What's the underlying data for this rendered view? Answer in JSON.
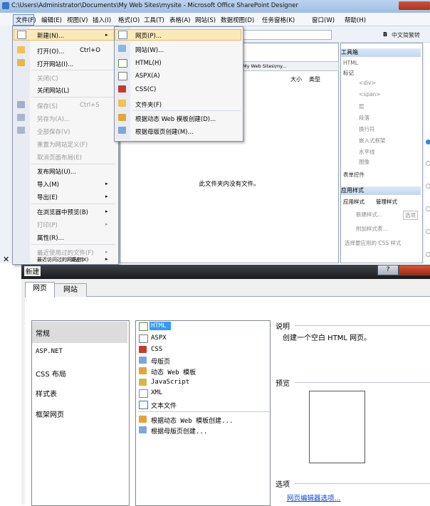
{
  "colors": {
    "accent": "#3399ff",
    "menu_highlight": "#fce9b9",
    "link": "#0645d6",
    "title_dark": "#181a1d"
  },
  "top": {
    "window_title": "C:\\Users\\Administrator\\Documents\\My Web Sites\\mysite - Microsoft Office SharePoint Designer",
    "menubar": [
      "文件(F)",
      "编辑(E)",
      "视图(V)",
      "插入(I)",
      "格式(O)",
      "工具(T)",
      "表格(A)",
      "网站(S)",
      "数据视图(D)",
      "任务窗格(K)",
      "窗口(W)",
      "帮助(H)"
    ],
    "toolbar_font": "中文简繁转",
    "toolbar_misc": "B",
    "file_menu": [
      {
        "label": "新建(N)...",
        "shortcut": "",
        "arrow": "▸",
        "disabled": false,
        "icon": "new-icon"
      },
      {
        "label": "打开(O)...",
        "shortcut": "Ctrl+O",
        "arrow": "",
        "disabled": false,
        "icon": "open-folder-icon"
      },
      {
        "label": "打开网站(I)...",
        "shortcut": "",
        "arrow": "",
        "disabled": false,
        "icon": "open-site-icon"
      },
      {
        "label": "关闭(C)",
        "shortcut": "",
        "arrow": "",
        "disabled": true,
        "icon": ""
      },
      {
        "label": "关闭网站(L)",
        "shortcut": "",
        "arrow": "",
        "disabled": false,
        "icon": ""
      },
      {
        "label": "保存(S)",
        "shortcut": "Ctrl+S",
        "arrow": "",
        "disabled": true,
        "icon": "save-icon"
      },
      {
        "label": "另存为(A)...",
        "shortcut": "",
        "arrow": "",
        "disabled": true,
        "icon": "save-as-icon"
      },
      {
        "label": "全部保存(V)",
        "shortcut": "",
        "arrow": "",
        "disabled": true,
        "icon": "save-all-icon"
      },
      {
        "label": "重置为网站定义(F)",
        "shortcut": "",
        "arrow": "",
        "disabled": true,
        "icon": ""
      },
      {
        "label": "取消页面布局(E)",
        "shortcut": "",
        "arrow": "",
        "disabled": true,
        "icon": ""
      },
      {
        "label": "发布网站(U)...",
        "shortcut": "",
        "arrow": "",
        "disabled": false,
        "icon": ""
      },
      {
        "label": "导入(M)",
        "shortcut": "",
        "arrow": "▸",
        "disabled": false,
        "icon": ""
      },
      {
        "label": "导出(E)",
        "shortcut": "",
        "arrow": "▸",
        "disabled": false,
        "icon": ""
      },
      {
        "label": "在浏览器中预览(B)",
        "shortcut": "",
        "arrow": "▸",
        "disabled": false,
        "icon": ""
      },
      {
        "label": "打印(P)",
        "shortcut": "",
        "arrow": "▸",
        "disabled": true,
        "icon": ""
      },
      {
        "label": "属性(R)...",
        "shortcut": "",
        "arrow": "",
        "disabled": false,
        "icon": ""
      },
      {
        "label": "最近使用过的文件(F)",
        "shortcut": "",
        "arrow": "▸",
        "disabled": true,
        "icon": ""
      },
      {
        "label": "最近访问过的网站(T)",
        "shortcut": "",
        "arrow": "▸",
        "disabled": false,
        "icon": ""
      },
      {
        "label": "退出(X)",
        "shortcut": "",
        "arrow": "",
        "disabled": false,
        "icon": "exit-icon"
      }
    ],
    "new_submenu": [
      "网页(P)...",
      "网站(W)...",
      "HTML(H)",
      "ASPX(A)",
      "CSS(C)",
      "文件夹(F)",
      "根据动态 Web 模板创建(D)...",
      "根据母版页创建(M)..."
    ],
    "path": "My Web Sites\\my...",
    "col_size": "大小",
    "col_type": "类型",
    "empty_msg": "此文件夹内没有文件。",
    "toolbox": {
      "title": "工具箱",
      "section_html": "HTML",
      "tags_header": "标记",
      "items": [
        "<div>",
        "<span>",
        "层",
        "段落",
        "换行符",
        "嵌入式框架",
        "水平线",
        "图像"
      ],
      "form_controls": "表单控件",
      "apply_styles_title": "应用样式",
      "tab_apply": "应用样式",
      "tab_manage": "管理样式",
      "new_style": "新建样式...",
      "options": "选项",
      "attach_style": "附加样式表...",
      "select_css": "选择要应用的 CSS 样式"
    }
  },
  "dialog": {
    "title": "新建",
    "help": "?",
    "tabs": [
      "网页",
      "网站"
    ],
    "categories": [
      "常规",
      "ASP.NET",
      "CSS 布局",
      "样式表",
      "框架网页"
    ],
    "types": [
      "HTML",
      "ASPX",
      "CSS",
      "母版页",
      "动态 Web 模板",
      "JavaScript",
      "XML",
      "文本文件"
    ],
    "extra_types": [
      "根据动态 Web 模板创建...",
      "根据母版页创建..."
    ],
    "desc_label": "说明",
    "desc_text": "创建一个空白 HTML 网页。",
    "preview_label": "预览",
    "options_label": "选项",
    "options_link": "网页编辑器选项..."
  }
}
